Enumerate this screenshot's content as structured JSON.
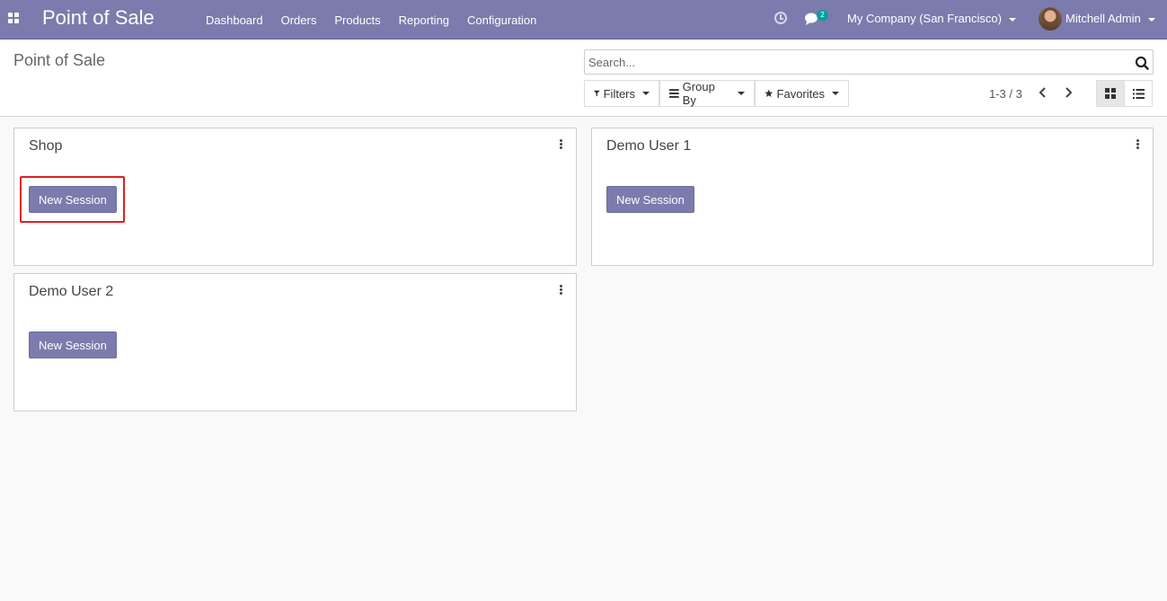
{
  "navbar": {
    "brand": "Point of Sale",
    "menu": [
      "Dashboard",
      "Orders",
      "Products",
      "Reporting",
      "Configuration"
    ],
    "chat_badge": "2",
    "company": "My Company (San Francisco)",
    "user": "Mitchell Admin"
  },
  "control_panel": {
    "title": "Point of Sale",
    "search_placeholder": "Search...",
    "filters_label": "Filters",
    "groupby_label": "Group By",
    "favorites_label": "Favorites",
    "pager": "1-3 / 3"
  },
  "cards": [
    {
      "title": "Shop",
      "button": "New Session"
    },
    {
      "title": "Demo User 1",
      "button": "New Session"
    },
    {
      "title": "Demo User 2",
      "button": "New Session"
    }
  ],
  "colors": {
    "brand": "#7c7bad",
    "highlight": "#e21c23",
    "badge": "#00a09d"
  }
}
